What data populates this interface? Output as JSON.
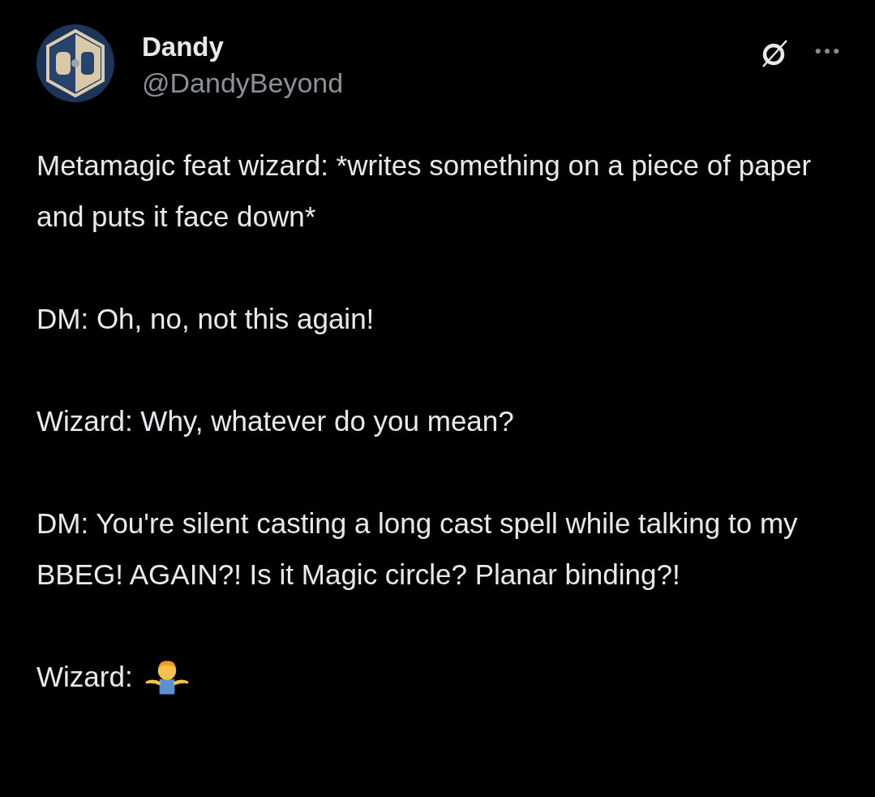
{
  "author": {
    "name": "Dandy",
    "handle": "@DandyBeyond"
  },
  "paragraphs": [
    "Metamagic feat wizard: *writes something on a piece of paper and puts it face down*",
    "DM: Oh, no, not this again!",
    "Wizard: Why, whatever do you mean?",
    "DM: You're silent casting a long cast spell while talking to my BBEG! AGAIN?! Is it Magic circle? Planar binding?!"
  ],
  "closing": {
    "text": "Wizard:"
  }
}
